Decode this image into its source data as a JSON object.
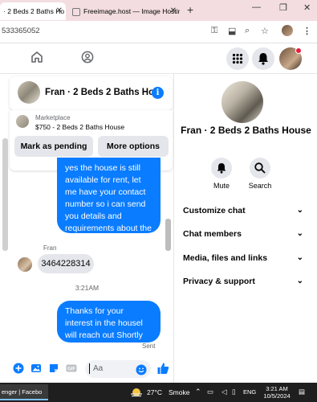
{
  "browser": {
    "tabs": [
      {
        "label": "· 2 Beds 2 Baths Ho"
      },
      {
        "label": "Freeimage.host — Image Hostin"
      }
    ],
    "url_fragment": "533365052"
  },
  "chat": {
    "title": "Fran · 2 Beds 2 Baths Ho",
    "marketplace_label": "Marketplace",
    "listing_title": "$750 - 2 Beds 2 Baths House",
    "mark_pending_label": "Mark as pending",
    "more_options_label": "More options",
    "outgoing_message_1": "yes the house is still available for rent, let me have your contact number so i can send you details and requirements about the house",
    "sender_name": "Fran",
    "incoming_message_1": "3464228314",
    "timestamp": "3:21AM",
    "outgoing_message_2": "Thanks for your interest in the housel will reach out Shortly",
    "sent_status": "Sent",
    "composer_placeholder": "Aa"
  },
  "details": {
    "title": "Fran · 2 Beds 2 Baths House",
    "mute_label": "Mute",
    "search_label": "Search",
    "sections": [
      "Customize chat",
      "Chat members",
      "Media, files and links",
      "Privacy & support"
    ]
  },
  "taskbar": {
    "app_label": "enger | Facebo",
    "temperature": "27°C",
    "weather": "Smoke",
    "language": "ENG",
    "time": "3:21 AM",
    "date": "10/5/2024"
  },
  "colors": {
    "messenger_blue": "#0a7cff",
    "bubble_gray": "#e4e6eb",
    "tab_strip": "#f3dde0"
  }
}
